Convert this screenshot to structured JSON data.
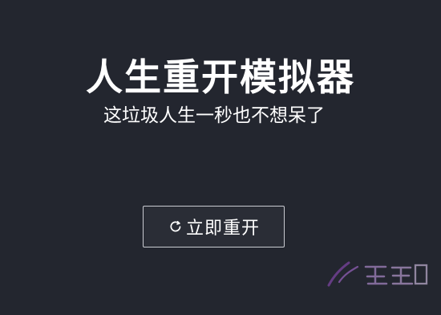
{
  "app": {
    "title": "人生重开模拟器",
    "subtitle": "这垃圾人生一秒也不想呆了"
  },
  "actions": {
    "restart_label": "立即重开",
    "restart_icon": "refresh-icon"
  },
  "theme": {
    "background": "#23262f",
    "text": "#ffffff",
    "button_border": "#c9cbd1"
  }
}
